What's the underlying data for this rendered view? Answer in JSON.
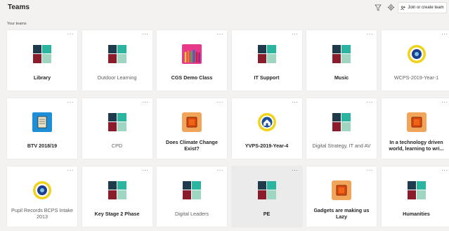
{
  "header": {
    "title": "Teams",
    "join_label": "Join or create team",
    "filter_icon": "filter-icon",
    "settings_icon": "gear-icon"
  },
  "section_label": "Your teams",
  "more_label": "···",
  "teams": [
    {
      "name": "Library",
      "logo": "tiles",
      "style": "bold"
    },
    {
      "name": "Outdoor Learning",
      "logo": "tiles",
      "style": "light"
    },
    {
      "name": "CGS Demo Class",
      "logo": "pencils",
      "style": "bold"
    },
    {
      "name": "IT Support",
      "logo": "tiles",
      "style": "bold"
    },
    {
      "name": "Music",
      "logo": "tiles",
      "style": "bold"
    },
    {
      "name": "WCPS-2019-Year-1",
      "logo": "badge",
      "style": "light"
    },
    {
      "name": "BTV 2018/19",
      "logo": "scroll",
      "style": "bold"
    },
    {
      "name": "CPD",
      "logo": "tiles",
      "style": "light"
    },
    {
      "name": "Does Climate Change Exist?",
      "logo": "orange",
      "style": "bold"
    },
    {
      "name": "YVPS-2019-Year-4",
      "logo": "badge-house",
      "style": "bold"
    },
    {
      "name": "Digital Strategy, IT and AV",
      "logo": "tiles",
      "style": "light"
    },
    {
      "name": "In a technology driven world, learning to wri...",
      "logo": "orange",
      "style": "bold"
    },
    {
      "name": "Pupil Records BCPS Intake 2013",
      "logo": "badge",
      "style": "light"
    },
    {
      "name": "Key Stage 2 Phase",
      "logo": "tiles",
      "style": "bold"
    },
    {
      "name": "Digital Leaders",
      "logo": "tiles",
      "style": "light"
    },
    {
      "name": "PE",
      "logo": "tiles",
      "style": "bold",
      "selected": true
    },
    {
      "name": "Gadgets are making us Lazy",
      "logo": "orange",
      "style": "bold"
    },
    {
      "name": "Humanities",
      "logo": "tiles",
      "style": "bold"
    }
  ],
  "colors": {
    "tile_teal": "#2bb5a0",
    "tile_dark": "#1f3a4a",
    "tile_maroon": "#8b1c2c",
    "tile_mint": "#9fd6c2",
    "orange": "#f0a55a"
  }
}
